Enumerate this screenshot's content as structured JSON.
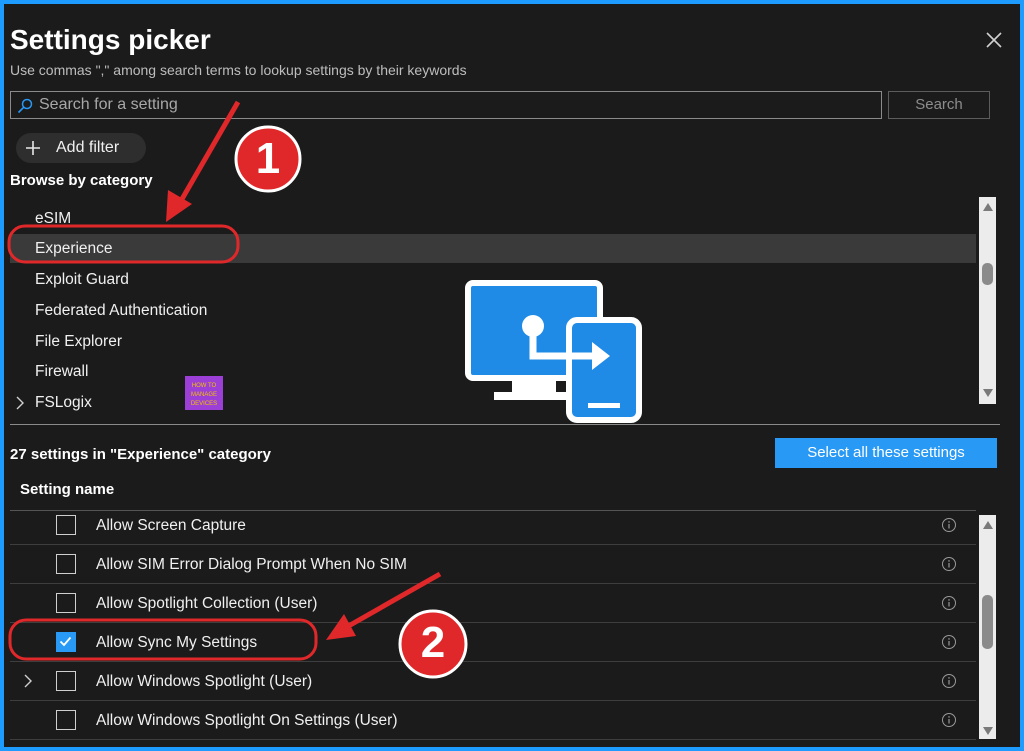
{
  "header": {
    "title": "Settings picker",
    "subtitle": "Use commas \",\" among search terms to lookup settings by their keywords"
  },
  "search": {
    "placeholder": "Search for a setting",
    "button_label": "Search"
  },
  "filter": {
    "add_label": "Add filter"
  },
  "browse": {
    "label": "Browse by category",
    "items": [
      {
        "label": "eSIM",
        "selected": false,
        "expandable": false
      },
      {
        "label": "Experience",
        "selected": true,
        "expandable": false
      },
      {
        "label": "Exploit Guard",
        "selected": false,
        "expandable": false
      },
      {
        "label": "Federated Authentication",
        "selected": false,
        "expandable": false
      },
      {
        "label": "File Explorer",
        "selected": false,
        "expandable": false
      },
      {
        "label": "Firewall",
        "selected": false,
        "expandable": false
      },
      {
        "label": "FSLogix",
        "selected": false,
        "expandable": true
      }
    ]
  },
  "results": {
    "count_text": "27 settings in \"Experience\" category",
    "select_all_label": "Select all these settings",
    "column_header": "Setting name",
    "rows": [
      {
        "label": "Allow Screen Capture",
        "checked": false,
        "expandable": false
      },
      {
        "label": "Allow SIM Error Dialog Prompt When No SIM",
        "checked": false,
        "expandable": false
      },
      {
        "label": "Allow Spotlight Collection (User)",
        "checked": false,
        "expandable": false
      },
      {
        "label": "Allow Sync My Settings",
        "checked": true,
        "expandable": false
      },
      {
        "label": "Allow Windows Spotlight (User)",
        "checked": false,
        "expandable": true
      },
      {
        "label": "Allow Windows Spotlight On Settings (User)",
        "checked": false,
        "expandable": false
      }
    ]
  },
  "annotations": {
    "step1": "1",
    "step2": "2",
    "color_red": "#e0282a",
    "watermark_text": "HOW TO MANAGE DEVICES"
  },
  "colors": {
    "accent": "#2899f5",
    "background": "#1b1b1b",
    "frame": "#1e9bff"
  }
}
